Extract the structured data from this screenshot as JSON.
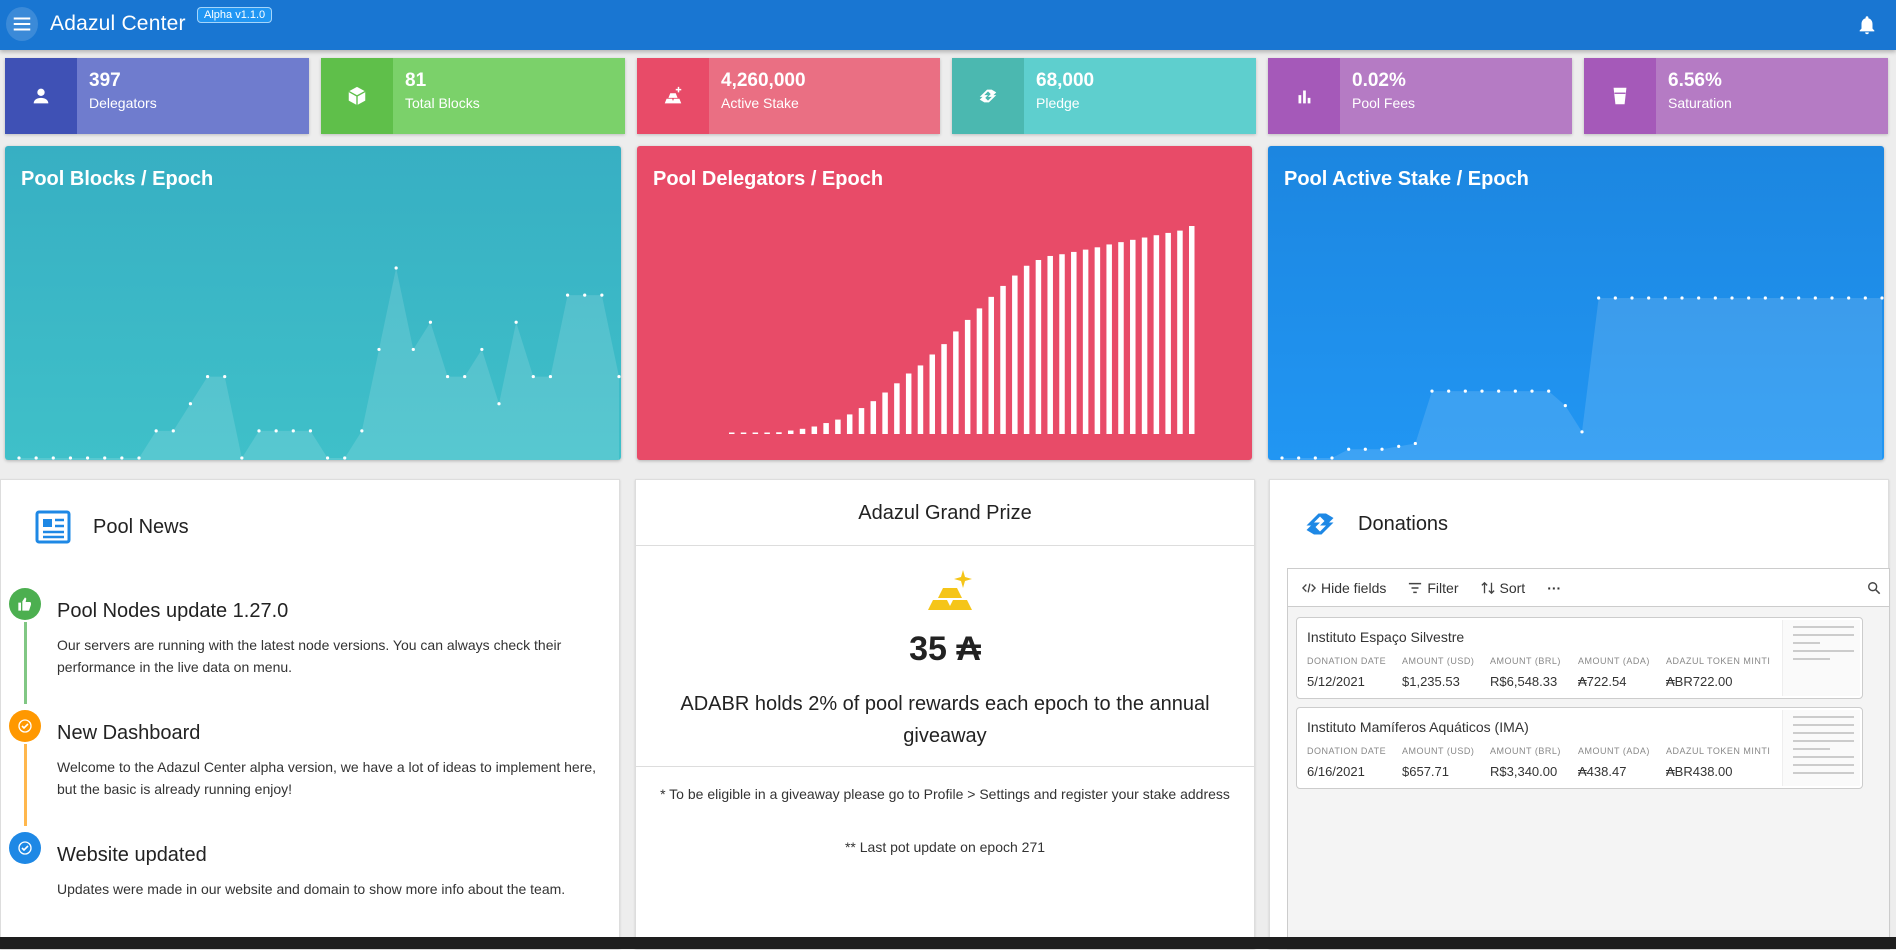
{
  "app": {
    "title": "Adazul Center",
    "version": "Alpha v1.1.0"
  },
  "colors": {
    "appbar": "#1976d2",
    "blue": "#6f7cce",
    "green": "#7bd16a",
    "red": "#ea6f83",
    "teal": "#5ecfce",
    "purple": "#b57bc4",
    "pink": "#e84b68",
    "chart_teal": "#3bb3c3"
  },
  "stats": [
    {
      "value": "397",
      "label": "Delegators",
      "icon": "person-icon"
    },
    {
      "value": "81",
      "label": "Total Blocks",
      "icon": "cube-icon"
    },
    {
      "value": "4,260,000",
      "label": "Active Stake",
      "icon": "gold-bars-icon"
    },
    {
      "value": "68,000",
      "label": "Pledge",
      "icon": "handshake-icon"
    },
    {
      "value": "0.02%",
      "label": "Pool Fees",
      "icon": "bar-chart-icon"
    },
    {
      "value": "6.56%",
      "label": "Saturation",
      "icon": "cup-icon"
    }
  ],
  "chart_data": [
    {
      "type": "area",
      "title": "Pool Blocks / Epoch",
      "values": [
        0,
        0,
        0,
        0,
        0,
        0,
        0,
        0,
        1,
        1,
        2,
        3,
        3,
        0,
        1,
        1,
        1,
        1,
        0,
        0,
        1,
        4,
        7,
        4,
        5,
        3,
        3,
        4,
        2,
        5,
        3,
        3,
        6,
        6,
        6,
        3
      ]
    },
    {
      "type": "bar",
      "title": "Pool Delegators / Epoch",
      "values": [
        0,
        1,
        1,
        2,
        3,
        6,
        9,
        13,
        19,
        25,
        34,
        45,
        57,
        72,
        88,
        105,
        119,
        138,
        156,
        178,
        198,
        218,
        238,
        257,
        275,
        292,
        302,
        309,
        312,
        316,
        320,
        324,
        329,
        333,
        337,
        341,
        345,
        349,
        353,
        361
      ]
    },
    {
      "type": "area",
      "title": "Pool Active Stake / Epoch",
      "values": [
        0,
        0,
        0,
        0,
        0.3,
        0.3,
        0.3,
        0.4,
        0.5,
        2.3,
        2.3,
        2.3,
        2.3,
        2.3,
        2.3,
        2.3,
        2.3,
        1.8,
        0.9,
        5.5,
        5.5,
        5.5,
        5.5,
        5.5,
        5.5,
        5.5,
        5.5,
        5.5,
        5.5,
        5.5,
        5.5,
        5.5,
        5.5,
        5.5,
        5.5,
        5.5,
        5.5
      ]
    }
  ],
  "news": {
    "title": "Pool News",
    "items": [
      {
        "title": "Pool Nodes update 1.27.0",
        "text": "Our servers are running with the latest node versions. You can always check their performance in the live data on menu."
      },
      {
        "title": "New Dashboard",
        "text": "Welcome to the Adazul Center alpha version, we have a lot of ideas to implement here, but the basic is already running enjoy!"
      },
      {
        "title": "Website updated",
        "text": "Updates were made in our website and domain to show more info about the team."
      }
    ]
  },
  "prize": {
    "title": "Adazul Grand Prize",
    "amount": "35 ₳",
    "description": "ADABR holds 2% of pool rewards each epoch to the annual giveaway",
    "note1": "* To be eligible in a giveaway please go to Profile > Settings and register your stake address",
    "note2": "** Last pot update on epoch 271"
  },
  "donations": {
    "title": "Donations",
    "toolbar": {
      "hide": "Hide fields",
      "filter": "Filter",
      "sort": "Sort",
      "more": "···"
    },
    "columns": [
      "DONATION DATE",
      "AMOUNT (USD)",
      "AMOUNT (BRL)",
      "AMOUNT (ADA)",
      "ADAZUL TOKEN MINTI"
    ],
    "records": [
      {
        "name": "Instituto Espaço Silvestre",
        "values": [
          "5/12/2021",
          "$1,235.53",
          "R$6,548.33",
          "₳722.54",
          "₳BR722.00"
        ]
      },
      {
        "name": "Instituto Mamíferos Aquáticos (IMA)",
        "values": [
          "6/16/2021",
          "$657.71",
          "R$3,340.00",
          "₳438.47",
          "₳BR438.00"
        ]
      }
    ]
  }
}
